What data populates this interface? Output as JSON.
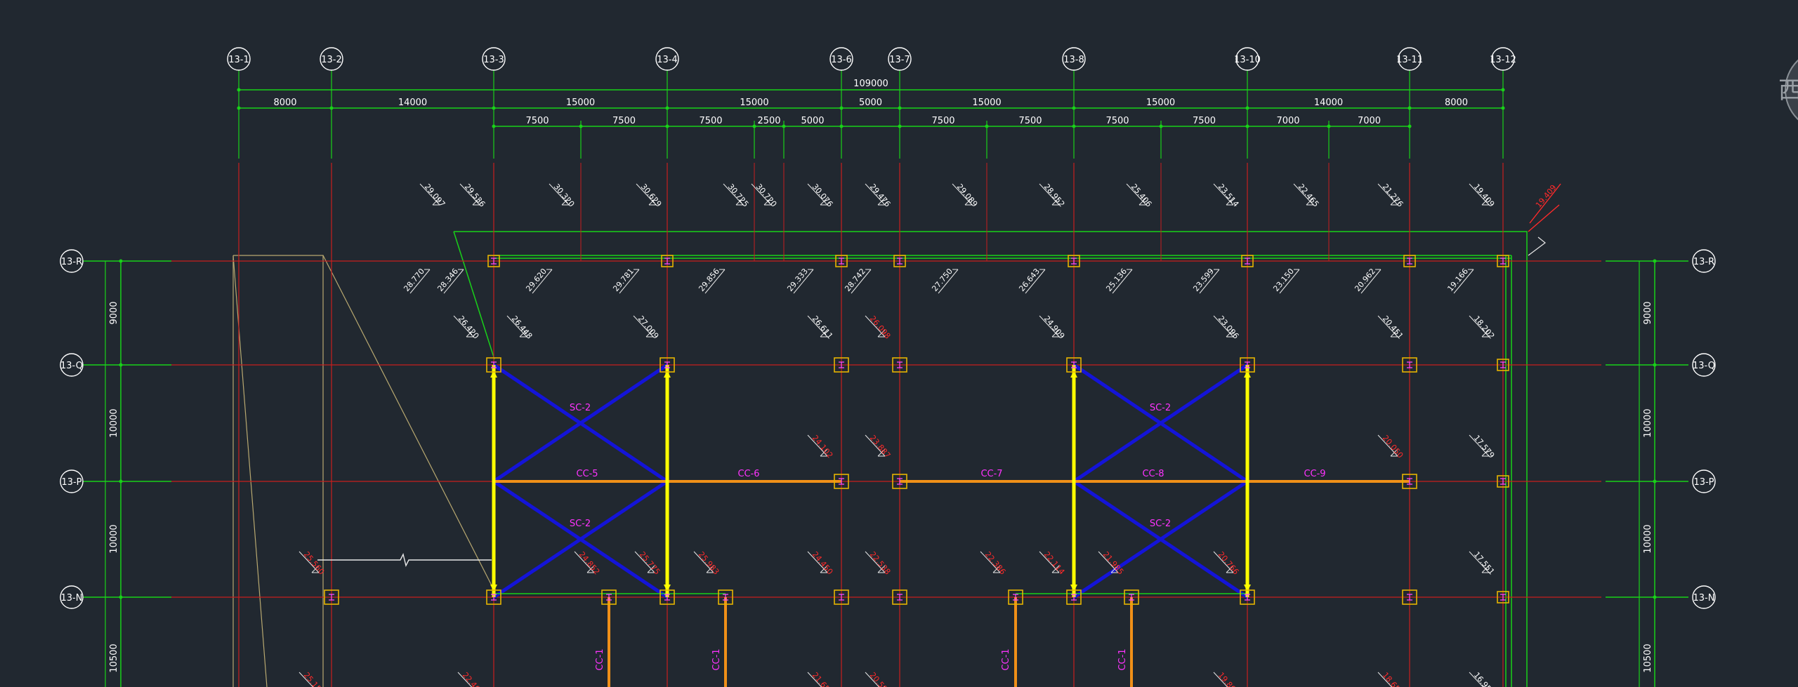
{
  "colors": {
    "background": "#212830",
    "grid_line": "#c81e1e",
    "dimension_line": "#19d119",
    "column": "#e6b400",
    "brace": "#1414d8",
    "strut": "#f09018",
    "post": "#ffff00",
    "member_label": "#ff33ff",
    "elev_white": "#ffffff",
    "elev_red": "#ff2a2a",
    "bubble": "#ffffff"
  },
  "overall_dimension": "109000",
  "top_grids": [
    {
      "id": "13-1",
      "label": "13-1"
    },
    {
      "id": "13-2",
      "label": "13-2"
    },
    {
      "id": "13-3",
      "label": "13-3"
    },
    {
      "id": "13-4",
      "label": "13-4"
    },
    {
      "id": "13-6",
      "label": "13-6"
    },
    {
      "id": "13-7",
      "label": "13-7"
    },
    {
      "id": "13-8",
      "label": "13-8"
    },
    {
      "id": "13-10",
      "label": "13-10"
    },
    {
      "id": "13-11",
      "label": "13-11"
    },
    {
      "id": "13-12",
      "label": "13-12"
    }
  ],
  "bay_dimensions": [
    "8000",
    "14000",
    "15000",
    "15000",
    "5000",
    "15000",
    "15000",
    "14000",
    "8000"
  ],
  "sub_dimensions": [
    "7500",
    "7500",
    "7500",
    "2500",
    "5000",
    "7500",
    "7500",
    "7500",
    "7500",
    "7000",
    "7000"
  ],
  "row_grids": [
    {
      "id": "13-R",
      "label": "13-R"
    },
    {
      "id": "13-Q",
      "label": "13-Q"
    },
    {
      "id": "13-P",
      "label": "13-P"
    },
    {
      "id": "13-N",
      "label": "13-N"
    }
  ],
  "side_dimensions": [
    "9000",
    "10000",
    "10000",
    "10500"
  ],
  "member_labels": {
    "sc_top_left": "SC-2",
    "sc_bottom_left": "SC-2",
    "sc_top_right": "SC-2",
    "sc_bottom_right": "SC-2",
    "cc5": "CC-5",
    "cc6": "CC-6",
    "cc7": "CC-7",
    "cc8": "CC-8",
    "cc9": "CC-9",
    "cc1_a": "CC-1",
    "cc1_b": "CC-1",
    "cc1_c": "CC-1",
    "cc1_d": "CC-1"
  },
  "elevations_top": [
    "29.097",
    "29.536",
    "30.320",
    "30.629",
    "30.725",
    "30.720",
    "30.076",
    "29.476",
    "29.089",
    "28.952",
    "25.406",
    "23.514",
    "22.465",
    "21.276",
    "19.409"
  ],
  "elevations_row_r": [
    "28.770",
    "28.346",
    "29.620",
    "29.781",
    "29.856",
    "29.333",
    "28.742",
    "27.750",
    "26.643",
    "25.136",
    "23.599",
    "23.150",
    "20.962",
    "19.166"
  ],
  "elevations_row_q": [
    "26.420",
    "26.448",
    "27.009",
    "26.611",
    "26.098",
    "24.909",
    "23.096",
    "20.451",
    "18.202"
  ],
  "elevations_row_p": [
    "24.102",
    "23.887",
    "20.050",
    "17.579"
  ],
  "elevations_row_n": [
    "25.560",
    "24.852",
    "25.775",
    "25.983",
    "24.450",
    "22.538",
    "22.386",
    "22.114",
    "21.985",
    "20.766",
    "17.551"
  ],
  "elevations_bottom": [
    "25.150",
    "22.460",
    "21.655",
    "20.598",
    "19.867",
    "18.655",
    "16.950"
  ],
  "red_callout_top": "19.409",
  "side_glyph": "西"
}
